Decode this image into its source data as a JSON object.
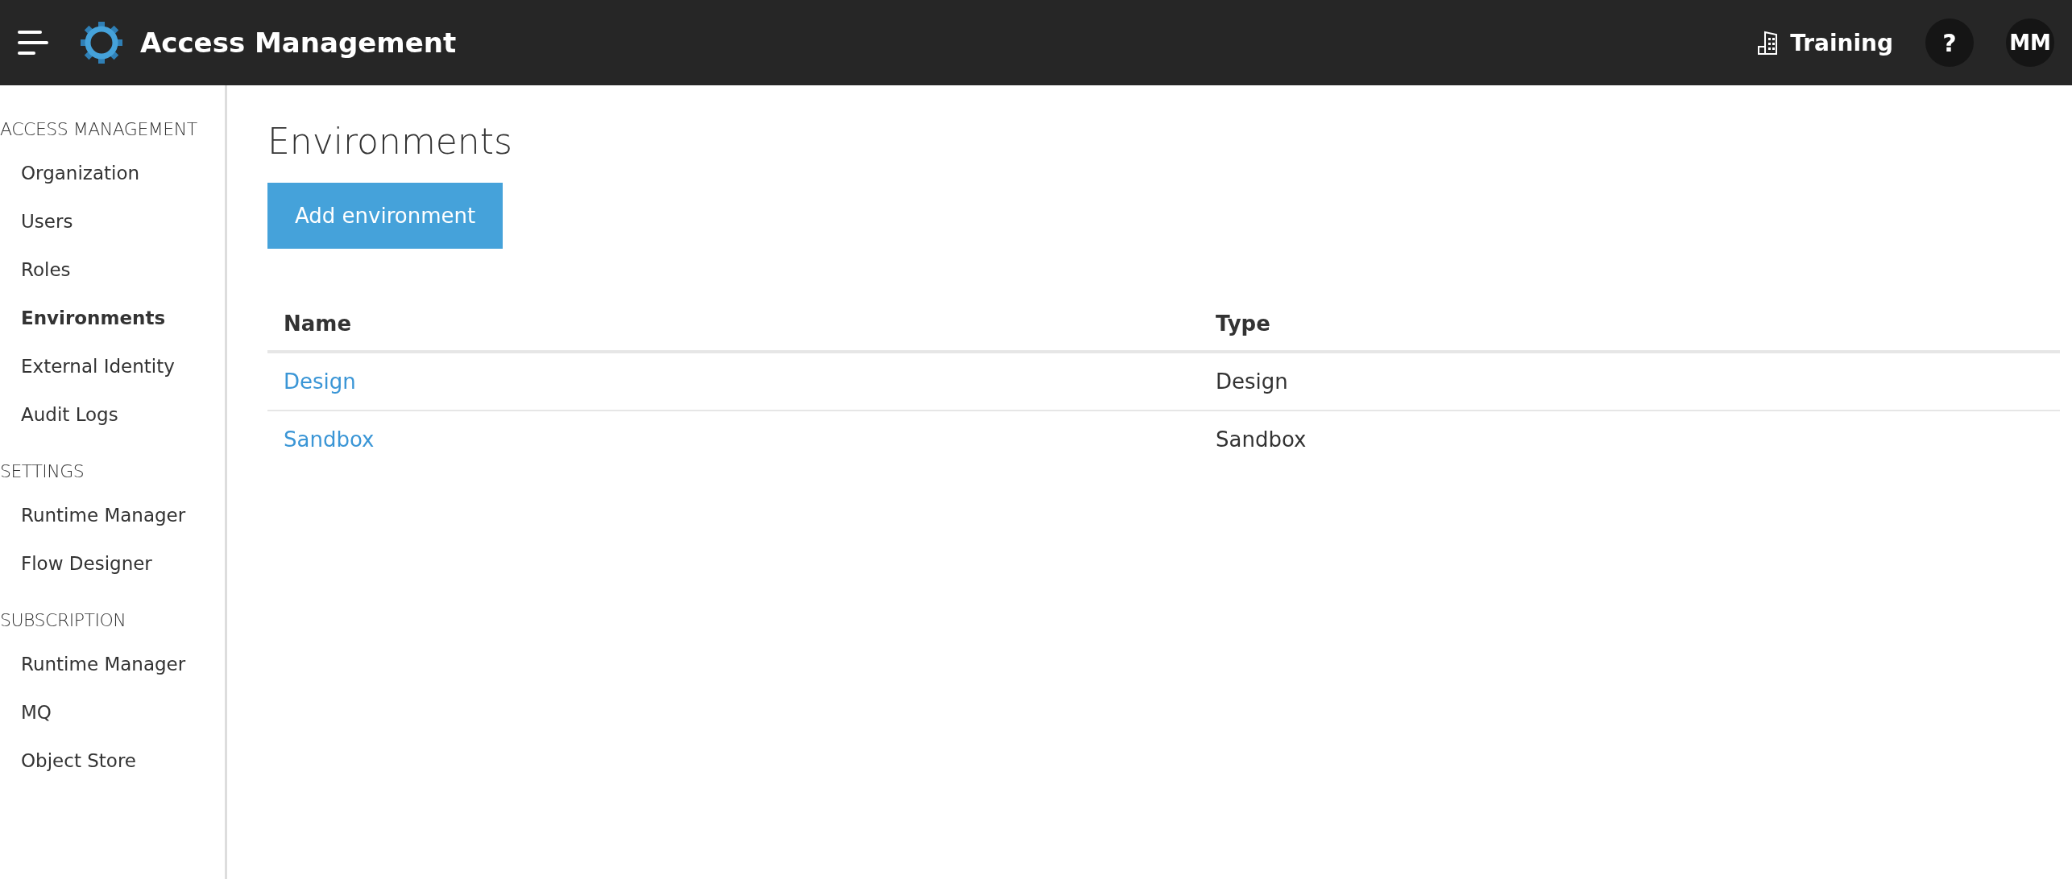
{
  "header": {
    "title": "Access Management",
    "environment": "Training",
    "help": "?",
    "avatar": "MM"
  },
  "sidebar": {
    "sections": [
      {
        "heading": "ACCESS MANAGEMENT",
        "items": [
          {
            "label": "Organization",
            "selected": false
          },
          {
            "label": "Users",
            "selected": false
          },
          {
            "label": "Roles",
            "selected": false
          },
          {
            "label": "Environments",
            "selected": true
          },
          {
            "label": "External Identity",
            "selected": false
          },
          {
            "label": "Audit Logs",
            "selected": false
          }
        ]
      },
      {
        "heading": "SETTINGS",
        "items": [
          {
            "label": "Runtime Manager",
            "selected": false
          },
          {
            "label": "Flow Designer",
            "selected": false
          }
        ]
      },
      {
        "heading": "SUBSCRIPTION",
        "items": [
          {
            "label": "Runtime Manager",
            "selected": false
          },
          {
            "label": "MQ",
            "selected": false
          },
          {
            "label": "Object Store",
            "selected": false
          }
        ]
      }
    ]
  },
  "page": {
    "title": "Environments",
    "add_button": "Add environment"
  },
  "table": {
    "columns": [
      "Name",
      "Type"
    ],
    "rows": [
      {
        "name": "Design",
        "type": "Design"
      },
      {
        "name": "Sandbox",
        "type": "Sandbox"
      }
    ]
  }
}
